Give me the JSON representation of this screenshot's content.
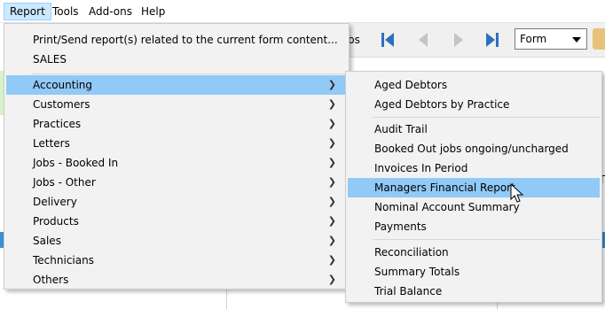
{
  "menubar": {
    "items": [
      {
        "label": "Report",
        "active": true
      },
      {
        "label": "Tools",
        "active": false
      },
      {
        "label": "Add-ons",
        "active": false
      },
      {
        "label": "Help",
        "active": false
      }
    ]
  },
  "toolbar": {
    "jobs_fragment": "bs",
    "view_combo": {
      "value": "Form"
    },
    "buttons": [
      "first-record-icon",
      "previous-record-icon",
      "next-record-icon",
      "last-record-icon"
    ]
  },
  "background": {
    "right_fragment": "T"
  },
  "report_menu": {
    "top_items": [
      "Print/Send report(s) related to the current form content...",
      "SALES"
    ],
    "submenus": [
      "Accounting",
      "Customers",
      "Practices",
      "Letters",
      "Jobs - Booked In",
      "Jobs - Other",
      "Delivery",
      "Products",
      "Sales",
      "Technicians",
      "Others"
    ],
    "highlighted": "Accounting"
  },
  "accounting_submenu": {
    "group1": [
      "Aged Debtors",
      "Aged Debtors by Practice"
    ],
    "group2": [
      "Audit Trail",
      "Booked Out jobs ongoing/uncharged",
      "Invoices In Period",
      "Managers Financial Report",
      "Nominal Account Summary",
      "Payments"
    ],
    "group3": [
      "Reconciliation",
      "Summary Totals",
      "Trial Balance"
    ],
    "highlighted": "Managers Financial Report"
  },
  "colors": {
    "menu_bg": "#f2f2f2",
    "highlight": "#91c9f7",
    "menubar_active": "#cce8ff",
    "nav_icon": "#2e6fc0"
  }
}
